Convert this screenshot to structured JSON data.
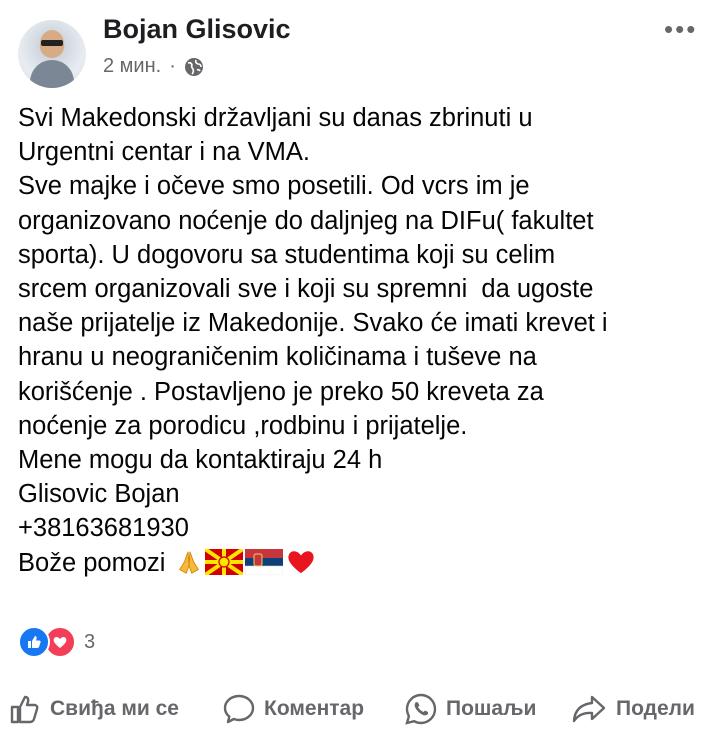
{
  "post": {
    "author": "Bojan Glisovic",
    "time": "2 мин.",
    "separator": "·",
    "more": "•••",
    "lines": [
      "Svi Makedonski državljani su danas zbrinuti u",
      "Urgentni centar i na VMA.",
      "Sve majke i očeve smo posetili. Od vcrs im je",
      "organizovano noćenje do daljnjeg na DIFu( fakultet",
      "sporta). U dogovoru sa studentima koji su celim",
      "srcem organizovali sve i koji su spremni  da ugoste",
      "naše prijatelje iz Makedonije. Svako će imati krevet i",
      "hranu u neograničenim količinama i tuševe na",
      "korišćenje . Postavljeno je preko 50 kreveta za",
      "noćenje za porodicu ,rodbinu i prijatelje.",
      "Mene mogu da kontaktiraju 24 h",
      "Glisovic Bojan",
      "+38163681930"
    ],
    "last_line_text": "Bože pomozi ",
    "emoji": [
      "praying-hands",
      "north-macedonia-flag",
      "serbia-flag",
      "red-heart"
    ]
  },
  "reactions": {
    "types": [
      "like",
      "love"
    ],
    "count": "3"
  },
  "actions": {
    "like": "Свиђа ми се",
    "comment": "Коментар",
    "send": "Пошаљи",
    "share": "Подели"
  },
  "colors": {
    "accent_blue": "#1877f2",
    "love_red": "#f33e58",
    "secondary_text": "#65676b"
  }
}
